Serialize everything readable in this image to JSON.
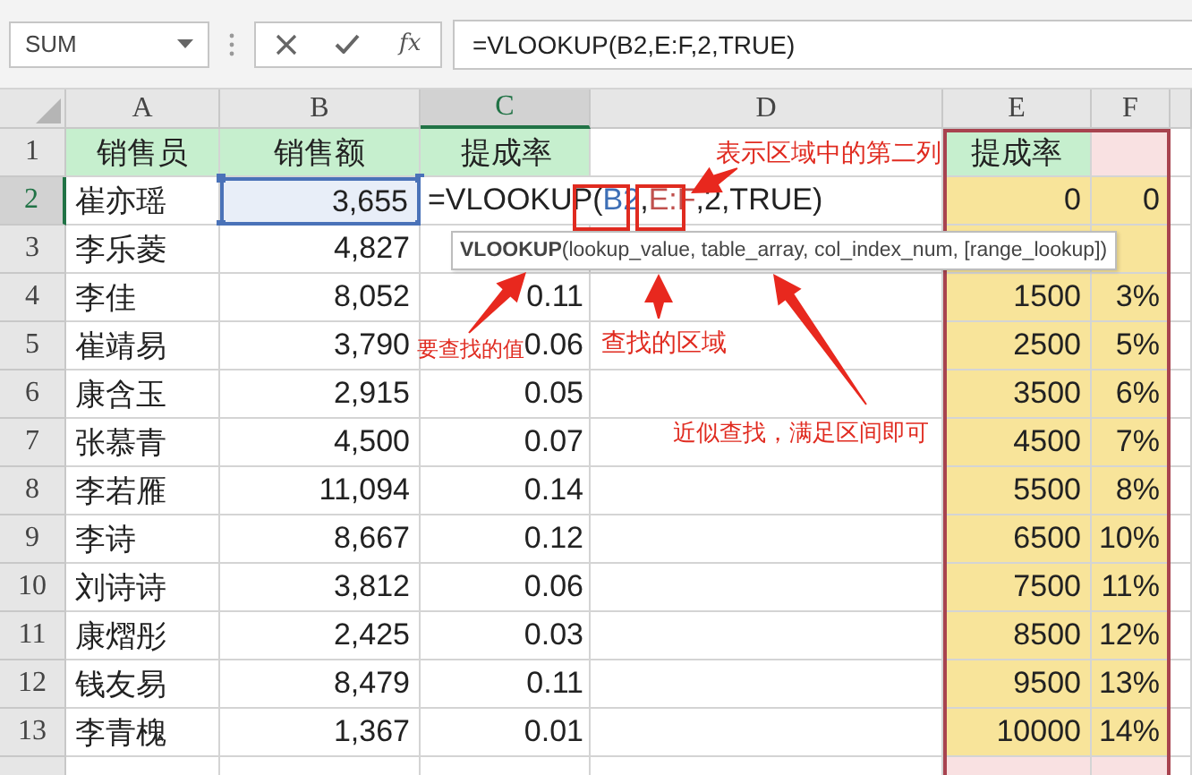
{
  "formula_bar": {
    "name_box": "SUM",
    "function_label": "fx",
    "formula": "=VLOOKUP(B2,E:F,2,TRUE)"
  },
  "columns": [
    {
      "label": "A",
      "selected": false
    },
    {
      "label": "B",
      "selected": false
    },
    {
      "label": "C",
      "selected": true
    },
    {
      "label": "D",
      "selected": false
    },
    {
      "label": "E",
      "selected": false
    },
    {
      "label": "F",
      "selected": false
    }
  ],
  "rows": [
    {
      "number": "1",
      "selected": false,
      "b_selected": false,
      "cells": {
        "a": "销售员",
        "b": "销售额",
        "c": "提成率",
        "e": "提成率"
      }
    },
    {
      "number": "2",
      "selected": true,
      "b_selected": true,
      "cells": {
        "a": "崔亦瑶",
        "b": "3,655",
        "e": "0",
        "f": "0"
      },
      "editing": [
        {
          "text": "=VLOOKUP(",
          "color": "#222222"
        },
        {
          "text": "B2",
          "color": "#3d6fb6"
        },
        {
          "text": ",",
          "color": "#222222"
        },
        {
          "text": "E:F",
          "color": "#c0504d"
        },
        {
          "text": ",2,TRUE)",
          "color": "#222222"
        }
      ]
    },
    {
      "number": "3",
      "selected": false,
      "b_selected": false,
      "cells": {
        "a": "李乐菱",
        "b": "4,827"
      }
    },
    {
      "number": "4",
      "selected": false,
      "b_selected": false,
      "cells": {
        "a": "李佳",
        "b": "8,052",
        "c": "0.11",
        "e": "1500",
        "f": "3%"
      }
    },
    {
      "number": "5",
      "selected": false,
      "b_selected": false,
      "cells": {
        "a": "崔靖易",
        "b": "3,790",
        "c": "0.06",
        "e": "2500",
        "f": "5%"
      }
    },
    {
      "number": "6",
      "selected": false,
      "b_selected": false,
      "cells": {
        "a": "康含玉",
        "b": "2,915",
        "c": "0.05",
        "e": "3500",
        "f": "6%"
      }
    },
    {
      "number": "7",
      "selected": false,
      "b_selected": false,
      "cells": {
        "a": "张慕青",
        "b": "4,500",
        "c": "0.07",
        "e": "4500",
        "f": "7%"
      }
    },
    {
      "number": "8",
      "selected": false,
      "b_selected": false,
      "cells": {
        "a": "李若雁",
        "b": "11,094",
        "c": "0.14",
        "e": "5500",
        "f": "8%"
      }
    },
    {
      "number": "9",
      "selected": false,
      "b_selected": false,
      "cells": {
        "a": "李诗",
        "b": "8,667",
        "c": "0.12",
        "e": "6500",
        "f": "10%"
      }
    },
    {
      "number": "10",
      "selected": false,
      "b_selected": false,
      "cells": {
        "a": "刘诗诗",
        "b": "3,812",
        "c": "0.06",
        "e": "7500",
        "f": "11%"
      }
    },
    {
      "number": "11",
      "selected": false,
      "b_selected": false,
      "cells": {
        "a": "康熠彤",
        "b": "2,425",
        "c": "0.03",
        "e": "8500",
        "f": "12%"
      }
    },
    {
      "number": "12",
      "selected": false,
      "b_selected": false,
      "cells": {
        "a": "钱友易",
        "b": "8,479",
        "c": "0.11",
        "e": "9500",
        "f": "13%"
      }
    },
    {
      "number": "13",
      "selected": false,
      "b_selected": false,
      "cells": {
        "a": "李青槐",
        "b": "1,367",
        "c": "0.01",
        "e": "10000",
        "f": "14%"
      }
    }
  ],
  "tooltip": "**VLOOKUP**(lookup_value, table_array, col_index_num, [range_lookup])",
  "annotations": [
    "表示区域中的第二列",
    "要查找的值",
    "查找的区域",
    "近似查找，满足区间即可"
  ]
}
